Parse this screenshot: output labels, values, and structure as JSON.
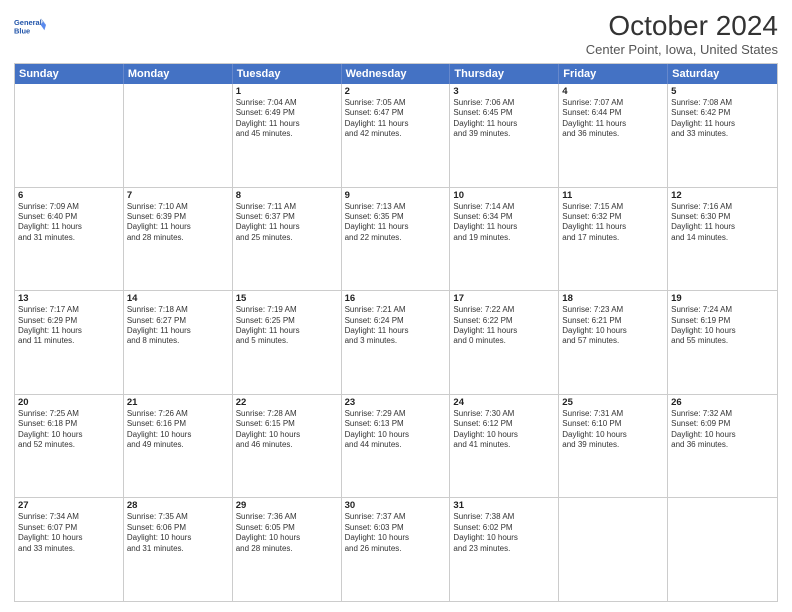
{
  "header": {
    "logo_line1": "General",
    "logo_line2": "Blue",
    "month": "October 2024",
    "location": "Center Point, Iowa, United States"
  },
  "weekdays": [
    "Sunday",
    "Monday",
    "Tuesday",
    "Wednesday",
    "Thursday",
    "Friday",
    "Saturday"
  ],
  "rows": [
    [
      {
        "day": "",
        "lines": []
      },
      {
        "day": "",
        "lines": []
      },
      {
        "day": "1",
        "lines": [
          "Sunrise: 7:04 AM",
          "Sunset: 6:49 PM",
          "Daylight: 11 hours",
          "and 45 minutes."
        ]
      },
      {
        "day": "2",
        "lines": [
          "Sunrise: 7:05 AM",
          "Sunset: 6:47 PM",
          "Daylight: 11 hours",
          "and 42 minutes."
        ]
      },
      {
        "day": "3",
        "lines": [
          "Sunrise: 7:06 AM",
          "Sunset: 6:45 PM",
          "Daylight: 11 hours",
          "and 39 minutes."
        ]
      },
      {
        "day": "4",
        "lines": [
          "Sunrise: 7:07 AM",
          "Sunset: 6:44 PM",
          "Daylight: 11 hours",
          "and 36 minutes."
        ]
      },
      {
        "day": "5",
        "lines": [
          "Sunrise: 7:08 AM",
          "Sunset: 6:42 PM",
          "Daylight: 11 hours",
          "and 33 minutes."
        ]
      }
    ],
    [
      {
        "day": "6",
        "lines": [
          "Sunrise: 7:09 AM",
          "Sunset: 6:40 PM",
          "Daylight: 11 hours",
          "and 31 minutes."
        ]
      },
      {
        "day": "7",
        "lines": [
          "Sunrise: 7:10 AM",
          "Sunset: 6:39 PM",
          "Daylight: 11 hours",
          "and 28 minutes."
        ]
      },
      {
        "day": "8",
        "lines": [
          "Sunrise: 7:11 AM",
          "Sunset: 6:37 PM",
          "Daylight: 11 hours",
          "and 25 minutes."
        ]
      },
      {
        "day": "9",
        "lines": [
          "Sunrise: 7:13 AM",
          "Sunset: 6:35 PM",
          "Daylight: 11 hours",
          "and 22 minutes."
        ]
      },
      {
        "day": "10",
        "lines": [
          "Sunrise: 7:14 AM",
          "Sunset: 6:34 PM",
          "Daylight: 11 hours",
          "and 19 minutes."
        ]
      },
      {
        "day": "11",
        "lines": [
          "Sunrise: 7:15 AM",
          "Sunset: 6:32 PM",
          "Daylight: 11 hours",
          "and 17 minutes."
        ]
      },
      {
        "day": "12",
        "lines": [
          "Sunrise: 7:16 AM",
          "Sunset: 6:30 PM",
          "Daylight: 11 hours",
          "and 14 minutes."
        ]
      }
    ],
    [
      {
        "day": "13",
        "lines": [
          "Sunrise: 7:17 AM",
          "Sunset: 6:29 PM",
          "Daylight: 11 hours",
          "and 11 minutes."
        ]
      },
      {
        "day": "14",
        "lines": [
          "Sunrise: 7:18 AM",
          "Sunset: 6:27 PM",
          "Daylight: 11 hours",
          "and 8 minutes."
        ]
      },
      {
        "day": "15",
        "lines": [
          "Sunrise: 7:19 AM",
          "Sunset: 6:25 PM",
          "Daylight: 11 hours",
          "and 5 minutes."
        ]
      },
      {
        "day": "16",
        "lines": [
          "Sunrise: 7:21 AM",
          "Sunset: 6:24 PM",
          "Daylight: 11 hours",
          "and 3 minutes."
        ]
      },
      {
        "day": "17",
        "lines": [
          "Sunrise: 7:22 AM",
          "Sunset: 6:22 PM",
          "Daylight: 11 hours",
          "and 0 minutes."
        ]
      },
      {
        "day": "18",
        "lines": [
          "Sunrise: 7:23 AM",
          "Sunset: 6:21 PM",
          "Daylight: 10 hours",
          "and 57 minutes."
        ]
      },
      {
        "day": "19",
        "lines": [
          "Sunrise: 7:24 AM",
          "Sunset: 6:19 PM",
          "Daylight: 10 hours",
          "and 55 minutes."
        ]
      }
    ],
    [
      {
        "day": "20",
        "lines": [
          "Sunrise: 7:25 AM",
          "Sunset: 6:18 PM",
          "Daylight: 10 hours",
          "and 52 minutes."
        ]
      },
      {
        "day": "21",
        "lines": [
          "Sunrise: 7:26 AM",
          "Sunset: 6:16 PM",
          "Daylight: 10 hours",
          "and 49 minutes."
        ]
      },
      {
        "day": "22",
        "lines": [
          "Sunrise: 7:28 AM",
          "Sunset: 6:15 PM",
          "Daylight: 10 hours",
          "and 46 minutes."
        ]
      },
      {
        "day": "23",
        "lines": [
          "Sunrise: 7:29 AM",
          "Sunset: 6:13 PM",
          "Daylight: 10 hours",
          "and 44 minutes."
        ]
      },
      {
        "day": "24",
        "lines": [
          "Sunrise: 7:30 AM",
          "Sunset: 6:12 PM",
          "Daylight: 10 hours",
          "and 41 minutes."
        ]
      },
      {
        "day": "25",
        "lines": [
          "Sunrise: 7:31 AM",
          "Sunset: 6:10 PM",
          "Daylight: 10 hours",
          "and 39 minutes."
        ]
      },
      {
        "day": "26",
        "lines": [
          "Sunrise: 7:32 AM",
          "Sunset: 6:09 PM",
          "Daylight: 10 hours",
          "and 36 minutes."
        ]
      }
    ],
    [
      {
        "day": "27",
        "lines": [
          "Sunrise: 7:34 AM",
          "Sunset: 6:07 PM",
          "Daylight: 10 hours",
          "and 33 minutes."
        ]
      },
      {
        "day": "28",
        "lines": [
          "Sunrise: 7:35 AM",
          "Sunset: 6:06 PM",
          "Daylight: 10 hours",
          "and 31 minutes."
        ]
      },
      {
        "day": "29",
        "lines": [
          "Sunrise: 7:36 AM",
          "Sunset: 6:05 PM",
          "Daylight: 10 hours",
          "and 28 minutes."
        ]
      },
      {
        "day": "30",
        "lines": [
          "Sunrise: 7:37 AM",
          "Sunset: 6:03 PM",
          "Daylight: 10 hours",
          "and 26 minutes."
        ]
      },
      {
        "day": "31",
        "lines": [
          "Sunrise: 7:38 AM",
          "Sunset: 6:02 PM",
          "Daylight: 10 hours",
          "and 23 minutes."
        ]
      },
      {
        "day": "",
        "lines": []
      },
      {
        "day": "",
        "lines": []
      }
    ]
  ]
}
